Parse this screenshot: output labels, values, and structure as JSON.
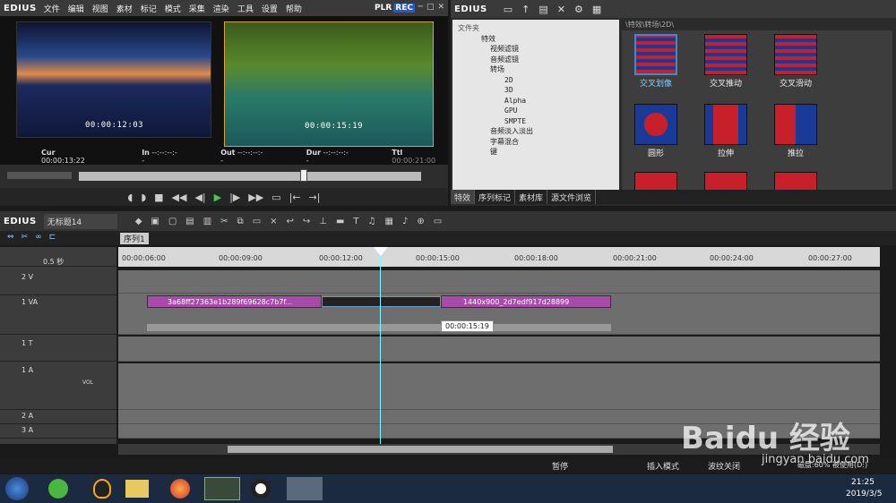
{
  "menubar": {
    "logo": "EDIUS",
    "items": [
      "文件",
      "编辑",
      "视图",
      "素材",
      "标记",
      "模式",
      "采集",
      "渲染",
      "工具",
      "设置",
      "帮助"
    ],
    "plr": "PLR",
    "rec": "REC"
  },
  "player": {
    "tc_left": "00:00:12:03",
    "tc_right": "00:00:15:19",
    "cur_label": "Cur",
    "cur": "00:00:13:22",
    "in_label": "In",
    "in": "--:--:--:--",
    "out_label": "Out",
    "out": "--:--:--:--",
    "dur_label": "Dur",
    "dur": "--:--:--:--",
    "ttl_label": "Ttl",
    "ttl": "00:00:21:00"
  },
  "right": {
    "logo": "EDIUS",
    "folder_header": "文件夹",
    "grid_header": "\\特效\\转场\\2D\\",
    "tree": [
      "特效",
      "视频滤镜",
      "音频滤镜",
      "转场",
      "2D",
      "3D",
      "Alpha",
      "GPU",
      "SMPTE",
      "音频淡入淡出",
      "字幕混合",
      "键"
    ],
    "tiles": [
      "交叉划像",
      "交叉推动",
      "交叉滑动",
      "圆形",
      "拉伸",
      "推拉"
    ],
    "tabs": [
      "特效",
      "序列标记",
      "素材库",
      "源文件浏览"
    ]
  },
  "timeline": {
    "logo": "EDIUS",
    "project": "无标题14",
    "seq": "序列1",
    "zoom": "0.5 秒",
    "ruler": [
      "00:00:06:00",
      "00:00:09:00",
      "00:00:12:00",
      "00:00:15:00",
      "00:00:18:00",
      "00:00:21:00",
      "00:00:24:00",
      "00:00:27:00"
    ],
    "tracks": [
      "2 V",
      "1 VA",
      "1 T",
      "1 A",
      "2 A",
      "3 A"
    ],
    "vol": "VOL",
    "clip1": "3a68ff27363e1b289f69628c7b7f...",
    "clip2": "1440x900_2d7edf917d28899",
    "tooltip": "00:00:15:19"
  },
  "status": {
    "pause": "暂停",
    "insert": "插入模式",
    "ripple": "波纹关闭",
    "disk": "磁盘:60% 被使用(D:)"
  },
  "taskbar": {
    "time": "21:25",
    "date": "2019/3/5"
  },
  "watermark": {
    "site": "jingyan.baidu.com"
  }
}
